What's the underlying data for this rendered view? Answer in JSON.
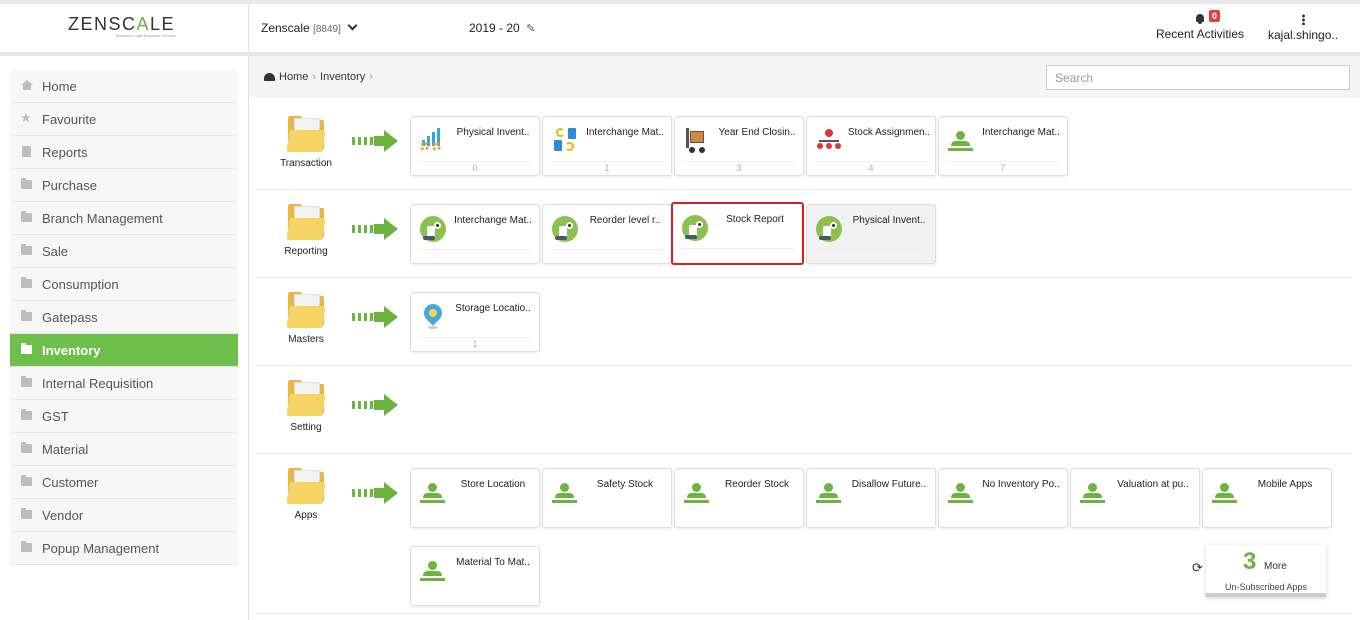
{
  "header": {
    "logo_prefix": "ZENSC",
    "logo_accent": "A",
    "logo_suffix": "LE",
    "tagline": "Business Logic Business Process",
    "company": "Zenscale",
    "company_code": "[8849]",
    "year": "2019 - 20",
    "activities_label": "Recent Activities",
    "activities_badge": "0",
    "user": "kajal.shingo.."
  },
  "sidebar": {
    "items": [
      {
        "label": "Home",
        "icon": "home-icon"
      },
      {
        "label": "Favourite",
        "icon": "star-icon"
      },
      {
        "label": "Reports",
        "icon": "document-icon"
      },
      {
        "label": "Purchase",
        "icon": "folder-icon"
      },
      {
        "label": "Branch Management",
        "icon": "folder-icon"
      },
      {
        "label": "Sale",
        "icon": "folder-icon"
      },
      {
        "label": "Consumption",
        "icon": "folder-icon"
      },
      {
        "label": "Gatepass",
        "icon": "folder-icon"
      },
      {
        "label": "Inventory",
        "icon": "folder-icon",
        "active": true
      },
      {
        "label": "Internal Requisition",
        "icon": "folder-icon"
      },
      {
        "label": "GST",
        "icon": "folder-icon"
      },
      {
        "label": "Material",
        "icon": "folder-icon"
      },
      {
        "label": "Customer",
        "icon": "folder-icon"
      },
      {
        "label": "Vendor",
        "icon": "folder-icon"
      },
      {
        "label": "Popup Management",
        "icon": "folder-icon"
      }
    ]
  },
  "breadcrumb": {
    "home": "Home",
    "current": "Inventory"
  },
  "search": {
    "placeholder": "Search"
  },
  "sections": {
    "transaction": {
      "label": "Transaction",
      "tiles": [
        {
          "title": "Physical Invent..",
          "count": "0",
          "icon": "chart-gears-icon"
        },
        {
          "title": "Interchange Mat..",
          "count": "1",
          "icon": "interchange-icon"
        },
        {
          "title": "Year End Closin..",
          "count": "3",
          "icon": "cart-icon"
        },
        {
          "title": "Stock Assignmen..",
          "count": "4",
          "icon": "hierarchy-icon"
        },
        {
          "title": "Interchange Mat..",
          "count": "7",
          "icon": "person-icon"
        }
      ]
    },
    "reporting": {
      "label": "Reporting",
      "tiles": [
        {
          "title": "Interchange Mat..",
          "icon": "report-icon"
        },
        {
          "title": "Reorder level r..",
          "icon": "report-icon"
        },
        {
          "title": "Stock Report",
          "icon": "report-icon"
        },
        {
          "title": "Physical Invent..",
          "icon": "report-icon"
        }
      ]
    },
    "masters": {
      "label": "Masters",
      "tiles": [
        {
          "title": "Storage Locatio..",
          "count": "1",
          "icon": "location-pin-icon"
        }
      ]
    },
    "setting": {
      "label": "Setting"
    },
    "apps": {
      "label": "Apps",
      "tiles": [
        {
          "title": "Store Location"
        },
        {
          "title": "Safety Stock"
        },
        {
          "title": "Reorder Stock"
        },
        {
          "title": "Disallow Future.."
        },
        {
          "title": "No Inventory Po.."
        },
        {
          "title": "Valuation at pu.."
        },
        {
          "title": "Mobile Apps"
        },
        {
          "title": "Material To Mat.."
        }
      ]
    }
  },
  "more_apps": {
    "count": "3",
    "label": "More",
    "sub": "Un-Subscribed Apps"
  },
  "colors": {
    "accent": "#6cb33f",
    "active_sidebar": "#6ebf4a",
    "highlight_border": "#d81e1e",
    "badge": "#d9413f"
  }
}
